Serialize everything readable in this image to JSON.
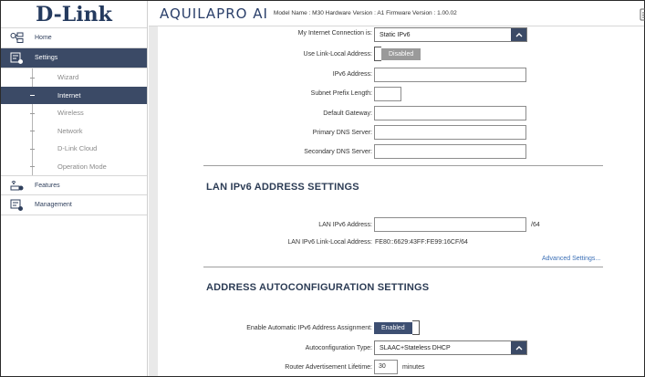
{
  "logo": "D-Link",
  "header": {
    "brand_main": "AQUILA",
    "brand_pro": "PRO AI",
    "info": "Model Name : M30 Hardware Version : A1 Firmware Version : 1.00.02"
  },
  "sidebar": {
    "home": "Home",
    "settings": "Settings",
    "sub_items": [
      "Wizard",
      "Internet",
      "Wireless",
      "Network",
      "D-Link Cloud",
      "Operation Mode"
    ],
    "active_sub_index": 1,
    "features": "Features",
    "management": "Management"
  },
  "ipv6": {
    "connection_label": "My Internet Connection is:",
    "connection_value": "Static IPv6",
    "link_local_label": "Use Link-Local Address:",
    "link_local_value": "Disabled",
    "address_label": "IPv6 Address:",
    "address_value": "",
    "prefix_label": "Subnet Prefix Length:",
    "prefix_value": "",
    "gateway_label": "Default Gateway:",
    "gateway_value": "",
    "primary_dns_label": "Primary DNS Server:",
    "primary_dns_value": "",
    "secondary_dns_label": "Secondary DNS Server:",
    "secondary_dns_value": ""
  },
  "lan": {
    "title": "LAN IPv6 ADDRESS SETTINGS",
    "address_label": "LAN IPv6 Address:",
    "address_value": "",
    "address_suffix": "/64",
    "link_local_label": "LAN IPv6 Link-Local Address:",
    "link_local_value": "FE80::6629:43FF:FE99:16CF/64",
    "advanced_link": "Advanced Settings..."
  },
  "autoconf": {
    "title": "ADDRESS AUTOCONFIGURATION SETTINGS",
    "enable_label": "Enable Automatic IPv6 Address Assignment:",
    "enable_value": "Enabled",
    "type_label": "Autoconfiguration Type:",
    "type_value": "SLAAC+Stateless DHCP",
    "lifetime_label": "Router Advertisement Lifetime:",
    "lifetime_value": "30",
    "lifetime_unit": "minutes"
  },
  "colors": {
    "nav_active": "#3b4a66",
    "toggle_disabled": "#9a9a9a",
    "toggle_enabled": "#3d4f72",
    "link": "#3b6fb6"
  }
}
